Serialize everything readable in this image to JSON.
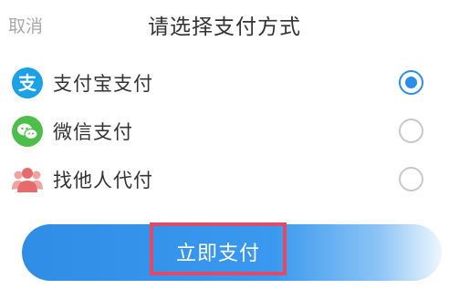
{
  "header": {
    "cancel_label": "取消",
    "title": "请选择支付方式"
  },
  "payment_methods": [
    {
      "label": "支付宝支付",
      "icon": "alipay-icon",
      "selected": true
    },
    {
      "label": "微信支付",
      "icon": "wechat-icon",
      "selected": false
    },
    {
      "label": "找他人代付",
      "icon": "friends-pay-icon",
      "selected": false
    }
  ],
  "pay_button": {
    "label": "立即支付"
  },
  "colors": {
    "accent_blue": "#2d8ee8",
    "alipay_blue": "#1aa1e6",
    "wechat_green": "#4cbf4b",
    "friends_red": "#e86b6b",
    "highlight_red": "#e04a68"
  }
}
